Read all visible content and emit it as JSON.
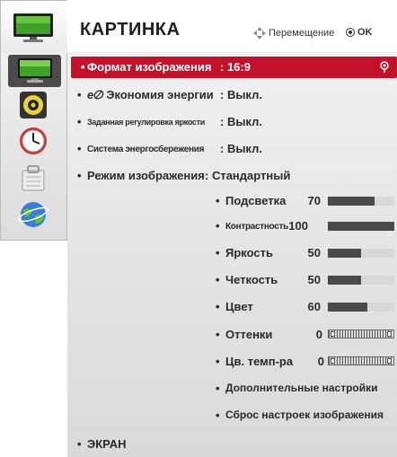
{
  "header": {
    "title": "КАРТИНКА",
    "nav_hint": "Перемещение",
    "ok_hint": "OK"
  },
  "sidebar": {
    "items": [
      {
        "icon": "tv-picture-icon",
        "selected": false
      },
      {
        "icon": "tv-picture-icon",
        "selected": true
      },
      {
        "icon": "speaker-audio-icon",
        "selected": false
      },
      {
        "icon": "clock-time-icon",
        "selected": false
      },
      {
        "icon": "lock-option-icon",
        "selected": false
      },
      {
        "icon": "globe-network-icon",
        "selected": false
      }
    ]
  },
  "menu": {
    "bullet": "•",
    "items": [
      {
        "label": "Формат изображения",
        "value": ": 16:9",
        "selected": true
      },
      {
        "label": "Экономия энергии",
        "eco_prefix": "e",
        "value": ": Выкл.",
        "selected": false
      },
      {
        "label": "Заданная регулировка яркости",
        "value": ": Выкл.",
        "selected": false
      },
      {
        "label": "Система энергосбережения",
        "value": ": Выкл.",
        "selected": false
      },
      {
        "label": "Режим изображения",
        "value": ": Стандартный",
        "selected": false
      }
    ]
  },
  "sub_settings": [
    {
      "label": "Подсветка",
      "value": "70",
      "level": 0.7
    },
    {
      "label": "Контрастность",
      "value": "100",
      "level": 1.0
    },
    {
      "label": "Яркость",
      "value": "50",
      "level": 0.5
    },
    {
      "label": "Четкость",
      "value": "50",
      "level": 0.5
    },
    {
      "label": "Цвет",
      "value": "60",
      "level": 0.6
    },
    {
      "label": "Оттенки",
      "value": "0"
    },
    {
      "label": "Цв. темп-ра",
      "value": "0"
    },
    {
      "label": "Дополнительные настройки"
    },
    {
      "label": "Сброс настроек изображения"
    }
  ],
  "bottom": {
    "label": "ЭКРАН"
  },
  "colors": {
    "accent": "#c4112b",
    "bar_fill": "#4a4a4a",
    "bar_bg": "#d8d8d8"
  }
}
